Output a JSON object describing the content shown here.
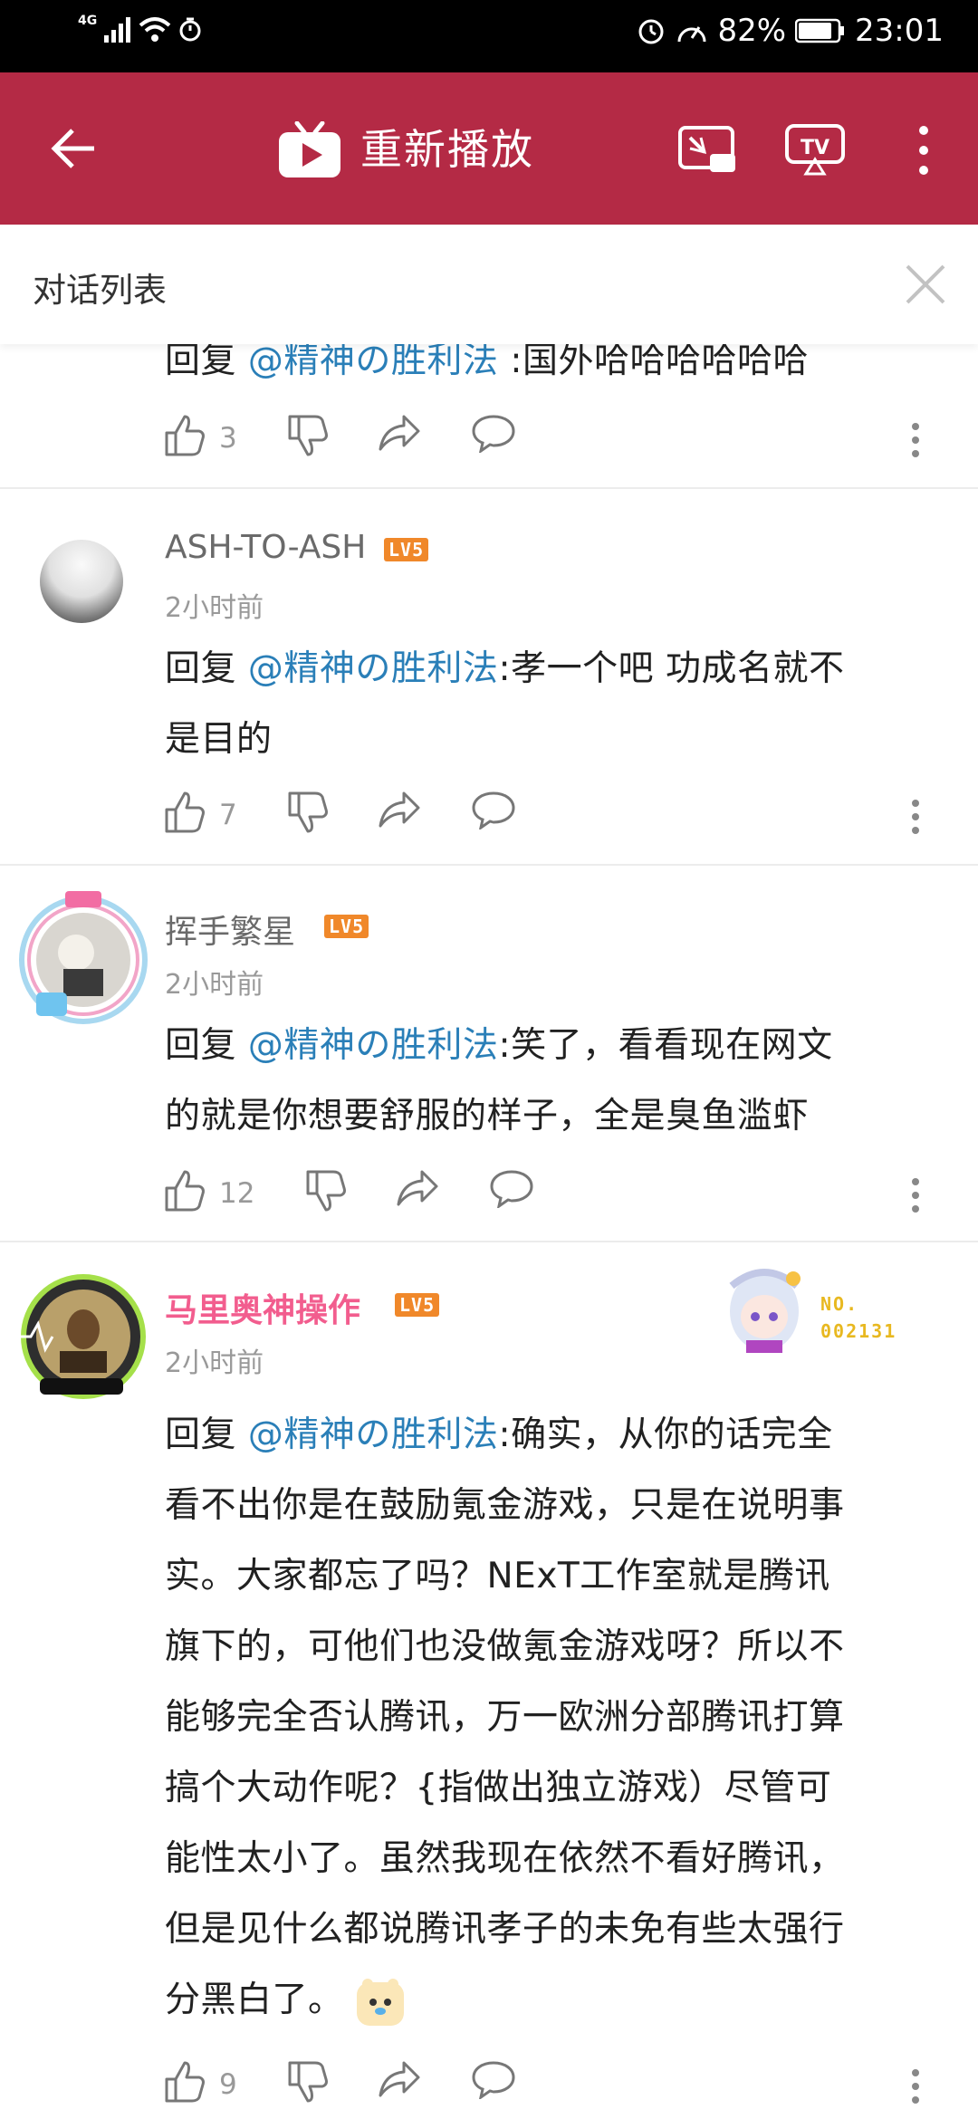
{
  "status_bar": {
    "network": "4G",
    "battery": "82%",
    "time": "23:01"
  },
  "app_bar": {
    "title": "重新播放"
  },
  "dialog": {
    "title": "对话列表"
  },
  "comments": [
    {
      "reply_prefix": "回复",
      "mention": "@精神の胜利法",
      "text_lines": [
        ":国外哈哈哈哈哈哈"
      ],
      "likes": "3"
    },
    {
      "username": "ASH-TO-ASH",
      "level": "LV5",
      "time": "2小时前",
      "reply_prefix": "回复",
      "mention": "@精神の胜利法",
      "line1": ":孝一个吧 功成名就不",
      "line2": "是目的",
      "likes": "7"
    },
    {
      "username": "挥手繁星",
      "level": "LV5",
      "time": "2小时前",
      "reply_prefix": "回复",
      "mention": "@精神の胜利法",
      "line1": ":笑了，看看现在网文",
      "line2": "的就是你想要舒服的样子，全是臭鱼滥虾",
      "likes": "12"
    },
    {
      "username": "马里奥神操作",
      "level": "LV5",
      "time": "2小时前",
      "badge_no": "NO.",
      "badge_num": "002131",
      "reply_prefix": "回复",
      "mention": "@精神の胜利法",
      "line1": ":确实，从你的话完全",
      "line2": "看不出你是在鼓励氪金游戏，只是在说明事",
      "line3": "实。大家都忘了吗？NExT工作室就是腾讯",
      "line4": "旗下的，可他们也没做氪金游戏呀？所以不",
      "line5": "能够完全否认腾讯，万一欧洲分部腾讯打算",
      "line6": "搞个大动作呢？{指做出独立游戏）尽管可",
      "line7": "能性太小了。虽然我现在依然不看好腾讯，",
      "line8": "但是见什么都说腾讯孝子的未免有些太强行",
      "line9": "分黑白了。",
      "likes": "9"
    }
  ]
}
